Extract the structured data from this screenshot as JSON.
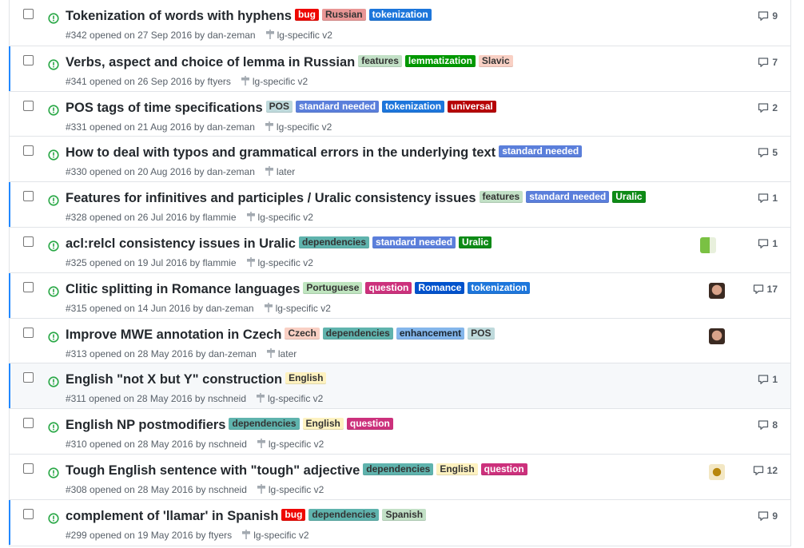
{
  "label_colors": {
    "bug": {
      "bg": "#ee0701",
      "fg": "#ffffff"
    },
    "Russian": {
      "bg": "#e99695",
      "fg": "#333333"
    },
    "tokenization": {
      "bg": "#1d76db",
      "fg": "#ffffff"
    },
    "features": {
      "bg": "#c2e0c6",
      "fg": "#333333"
    },
    "lemmatization": {
      "bg": "#009800",
      "fg": "#ffffff"
    },
    "Slavic": {
      "bg": "#f9d0c4",
      "fg": "#333333"
    },
    "POS": {
      "bg": "#bfdadc",
      "fg": "#333333"
    },
    "standard needed": {
      "bg": "#5b7fdb",
      "fg": "#ffffff"
    },
    "universal": {
      "bg": "#b60205",
      "fg": "#ffffff"
    },
    "Uralic": {
      "bg": "#0e8a16",
      "fg": "#ffffff"
    },
    "dependencies": {
      "bg": "#5fb3ad",
      "fg": "#333333"
    },
    "Portuguese": {
      "bg": "#bfe5bf",
      "fg": "#333333"
    },
    "question": {
      "bg": "#cc317c",
      "fg": "#ffffff"
    },
    "Romance": {
      "bg": "#0052cc",
      "fg": "#ffffff"
    },
    "Czech": {
      "bg": "#f9d0c4",
      "fg": "#333333"
    },
    "enhancement": {
      "bg": "#84b6eb",
      "fg": "#1c2733"
    },
    "English": {
      "bg": "#fef2c0",
      "fg": "#333333"
    },
    "Spanish": {
      "bg": "#c2e0c6",
      "fg": "#333333"
    }
  },
  "icons": {
    "state": "issue-opened-icon",
    "milestone": "milestone-icon",
    "comment": "comment-icon"
  },
  "issues": [
    {
      "title": "Tokenization of words with hyphens",
      "labels": [
        "bug",
        "Russian",
        "tokenization"
      ],
      "number": "#342",
      "opened": "opened on 27 Sep 2016 by",
      "author": "dan-zeman",
      "milestone": "lg-specific v2",
      "comments": "9",
      "avatar": null,
      "unread": false,
      "highlight": false
    },
    {
      "title": "Verbs, aspect and choice of lemma in Russian",
      "labels": [
        "features",
        "lemmatization",
        "Slavic"
      ],
      "number": "#341",
      "opened": "opened on 26 Sep 2016 by",
      "author": "ftyers",
      "milestone": "lg-specific v2",
      "comments": "7",
      "avatar": null,
      "unread": true,
      "highlight": false
    },
    {
      "title": "POS tags of time specifications",
      "labels": [
        "POS",
        "standard needed",
        "tokenization",
        "universal"
      ],
      "number": "#331",
      "opened": "opened on 21 Aug 2016 by",
      "author": "dan-zeman",
      "milestone": "lg-specific v2",
      "comments": "2",
      "avatar": null,
      "unread": false,
      "highlight": false
    },
    {
      "title": "How to deal with typos and grammatical errors in the underlying text",
      "labels": [
        "standard needed"
      ],
      "number": "#330",
      "opened": "opened on 20 Aug 2016 by",
      "author": "dan-zeman",
      "milestone": "later",
      "comments": "5",
      "avatar": null,
      "unread": false,
      "highlight": false
    },
    {
      "title": "Features for infinitives and participles / Uralic consistency issues",
      "labels": [
        "features",
        "standard needed",
        "Uralic"
      ],
      "number": "#328",
      "opened": "opened on 26 Jul 2016 by",
      "author": "flammie",
      "milestone": "lg-specific v2",
      "comments": "1",
      "avatar": null,
      "unread": true,
      "highlight": false
    },
    {
      "title": "acl:relcl consistency issues in Uralic",
      "labels": [
        "dependencies",
        "standard needed",
        "Uralic"
      ],
      "number": "#325",
      "opened": "opened on 19 Jul 2016 by",
      "author": "flammie",
      "milestone": "lg-specific v2",
      "comments": "1",
      "avatar": "green",
      "unread": false,
      "highlight": false
    },
    {
      "title": "Clitic splitting in Romance languages",
      "labels": [
        "Portuguese",
        "question",
        "Romance",
        "tokenization"
      ],
      "number": "#315",
      "opened": "opened on 14 Jun 2016 by",
      "author": "dan-zeman",
      "milestone": "lg-specific v2",
      "comments": "17",
      "avatar": "face",
      "unread": true,
      "highlight": false
    },
    {
      "title": "Improve MWE annotation in Czech",
      "labels": [
        "Czech",
        "dependencies",
        "enhancement",
        "POS"
      ],
      "number": "#313",
      "opened": "opened on 28 May 2016 by",
      "author": "dan-zeman",
      "milestone": "later",
      "comments": "",
      "avatar": "face",
      "unread": false,
      "highlight": false
    },
    {
      "title": "English \"not X but Y\" construction",
      "labels": [
        "English"
      ],
      "number": "#311",
      "opened": "opened on 28 May 2016 by",
      "author": "nschneid",
      "milestone": "lg-specific v2",
      "comments": "1",
      "avatar": null,
      "unread": true,
      "highlight": true
    },
    {
      "title": "English NP postmodifiers",
      "labels": [
        "dependencies",
        "English",
        "question"
      ],
      "number": "#310",
      "opened": "opened on 28 May 2016 by",
      "author": "nschneid",
      "milestone": "lg-specific v2",
      "comments": "8",
      "avatar": null,
      "unread": false,
      "highlight": false
    },
    {
      "title": "Tough English sentence with \"tough\" adjective",
      "labels": [
        "dependencies",
        "English",
        "question"
      ],
      "number": "#308",
      "opened": "opened on 28 May 2016 by",
      "author": "nschneid",
      "milestone": "lg-specific v2",
      "comments": "12",
      "avatar": "yellow",
      "unread": false,
      "highlight": false
    },
    {
      "title": "complement of 'llamar' in Spanish",
      "labels": [
        "bug",
        "dependencies",
        "Spanish"
      ],
      "number": "#299",
      "opened": "opened on 19 May 2016 by",
      "author": "ftyers",
      "milestone": "lg-specific v2",
      "comments": "9",
      "avatar": null,
      "unread": true,
      "highlight": false
    }
  ]
}
